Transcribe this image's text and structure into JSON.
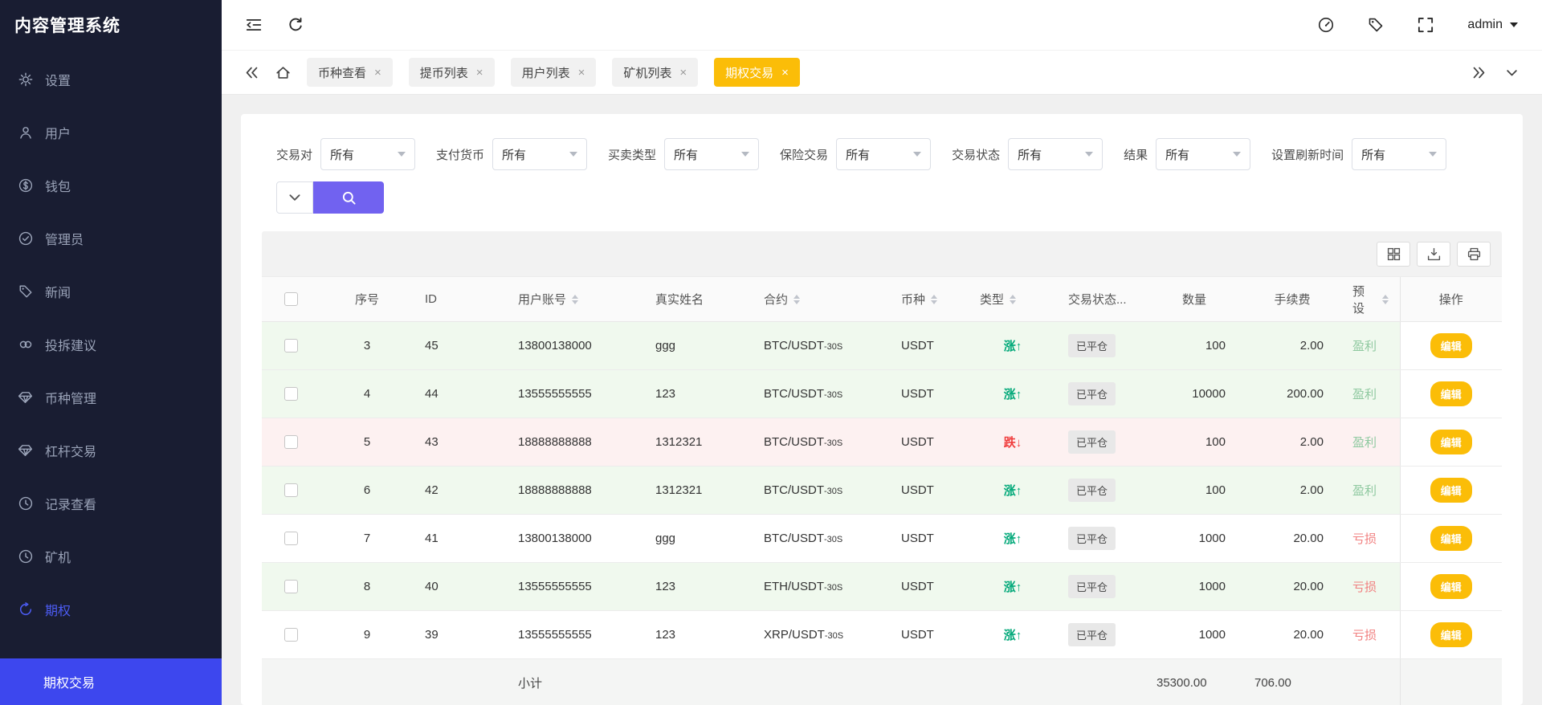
{
  "sidebar": {
    "title": "内容管理系统",
    "items": [
      {
        "label": "设置",
        "icon": "gear-icon"
      },
      {
        "label": "用户",
        "icon": "user-icon"
      },
      {
        "label": "钱包",
        "icon": "dollar-circle-icon"
      },
      {
        "label": "管理员",
        "icon": "check-badge-icon"
      },
      {
        "label": "新闻",
        "icon": "tag-icon"
      },
      {
        "label": "投拆建议",
        "icon": "link-icon"
      },
      {
        "label": "币种管理",
        "icon": "diamond-icon"
      },
      {
        "label": "杠杆交易",
        "icon": "diamond-icon"
      },
      {
        "label": "记录查看",
        "icon": "history-icon"
      },
      {
        "label": "矿机",
        "icon": "history-icon"
      },
      {
        "label": "期权",
        "icon": "refresh-circle-icon",
        "active": true
      }
    ],
    "active_submenu": "期权交易"
  },
  "topbar": {
    "username": "admin",
    "icons_left": [
      "sidebar-collapse-icon",
      "refresh-icon"
    ],
    "icons_right": [
      "dashboard-icon",
      "tag-icon",
      "fullscreen-icon"
    ]
  },
  "tabbar": {
    "close_glyph": "×",
    "tabs": [
      {
        "label": "币种查看"
      },
      {
        "label": "提币列表"
      },
      {
        "label": "用户列表"
      },
      {
        "label": "矿机列表"
      },
      {
        "label": "期权交易",
        "active": true
      }
    ]
  },
  "filters": {
    "collapse_icon": "chevron-down-icon",
    "search_icon": "search-icon",
    "fields": [
      {
        "label": "交易对",
        "value": "所有"
      },
      {
        "label": "支付货币",
        "value": "所有"
      },
      {
        "label": "买卖类型",
        "value": "所有"
      },
      {
        "label": "保险交易",
        "value": "所有"
      },
      {
        "label": "交易状态",
        "value": "所有"
      },
      {
        "label": "结果",
        "value": "所有"
      },
      {
        "label": "设置刷新时间",
        "value": "所有"
      }
    ]
  },
  "table": {
    "toolbar_icons": [
      "columns-icon",
      "export-icon",
      "print-icon"
    ],
    "columns": [
      {
        "label": "序号",
        "sortable": false
      },
      {
        "label": "ID",
        "sortable": false
      },
      {
        "label": "用户账号",
        "sortable": true
      },
      {
        "label": "真实姓名",
        "sortable": false
      },
      {
        "label": "合约",
        "sortable": true
      },
      {
        "label": "币种",
        "sortable": true
      },
      {
        "label": "类型",
        "sortable": true
      },
      {
        "label": "交易状态...",
        "sortable": false
      },
      {
        "label": "数量",
        "sortable": false
      },
      {
        "label": "手续费",
        "sortable": false
      },
      {
        "label": "预设",
        "sortable": true
      },
      {
        "label": "操作",
        "sortable": false
      }
    ],
    "edit_label": "编辑",
    "rows": [
      {
        "seq": "3",
        "id": "45",
        "account": "13800138000",
        "name": "ggg",
        "contract": "BTC/USDT",
        "contract_suffix": "-30S",
        "currency": "USDT",
        "type": "涨↑",
        "status": "已平仓",
        "amount": "100",
        "fee": "2.00",
        "preset": "盈利"
      },
      {
        "seq": "4",
        "id": "44",
        "account": "13555555555",
        "name": "123",
        "contract": "BTC/USDT",
        "contract_suffix": "-30S",
        "currency": "USDT",
        "type": "涨↑",
        "status": "已平仓",
        "amount": "10000",
        "fee": "200.00",
        "preset": "盈利"
      },
      {
        "seq": "5",
        "id": "43",
        "account": "18888888888",
        "name": "1312321",
        "contract": "BTC/USDT",
        "contract_suffix": "-30S",
        "currency": "USDT",
        "type": "跌↓",
        "status": "已平仓",
        "amount": "100",
        "fee": "2.00",
        "preset": "盈利"
      },
      {
        "seq": "6",
        "id": "42",
        "account": "18888888888",
        "name": "1312321",
        "contract": "BTC/USDT",
        "contract_suffix": "-30S",
        "currency": "USDT",
        "type": "涨↑",
        "status": "已平仓",
        "amount": "100",
        "fee": "2.00",
        "preset": "盈利"
      },
      {
        "seq": "7",
        "id": "41",
        "account": "13800138000",
        "name": "ggg",
        "contract": "BTC/USDT",
        "contract_suffix": "-30S",
        "currency": "USDT",
        "type": "涨↑",
        "status": "已平仓",
        "amount": "1000",
        "fee": "20.00",
        "preset": "亏损"
      },
      {
        "seq": "8",
        "id": "40",
        "account": "13555555555",
        "name": "123",
        "contract": "ETH/USDT",
        "contract_suffix": "-30S",
        "currency": "USDT",
        "type": "涨↑",
        "status": "已平仓",
        "amount": "1000",
        "fee": "20.00",
        "preset": "亏损"
      },
      {
        "seq": "9",
        "id": "39",
        "account": "13555555555",
        "name": "123",
        "contract": "XRP/USDT",
        "contract_suffix": "-30S",
        "currency": "USDT",
        "type": "涨↑",
        "status": "已平仓",
        "amount": "1000",
        "fee": "20.00",
        "preset": "亏损"
      }
    ],
    "subtotal": {
      "label": "小计",
      "amount": "35300.00",
      "fee": "706.00"
    }
  },
  "colors": {
    "sidebar_bg": "#191d32",
    "sidebar_active_bar": "#3d47ee",
    "sidebar_active_text": "#4c5cf3",
    "active_tab_bg": "#fbbd08",
    "edit_button_bg": "#fbbd08",
    "search_button_bg": "#7162f0",
    "type_up": "#00a878",
    "type_down": "#f03e3e",
    "preset_profit": "#8fc9a0",
    "preset_loss": "#f17f7f",
    "row_profit_bg": "#f0f9ee",
    "row_down_bg": "#fdf1f1"
  }
}
